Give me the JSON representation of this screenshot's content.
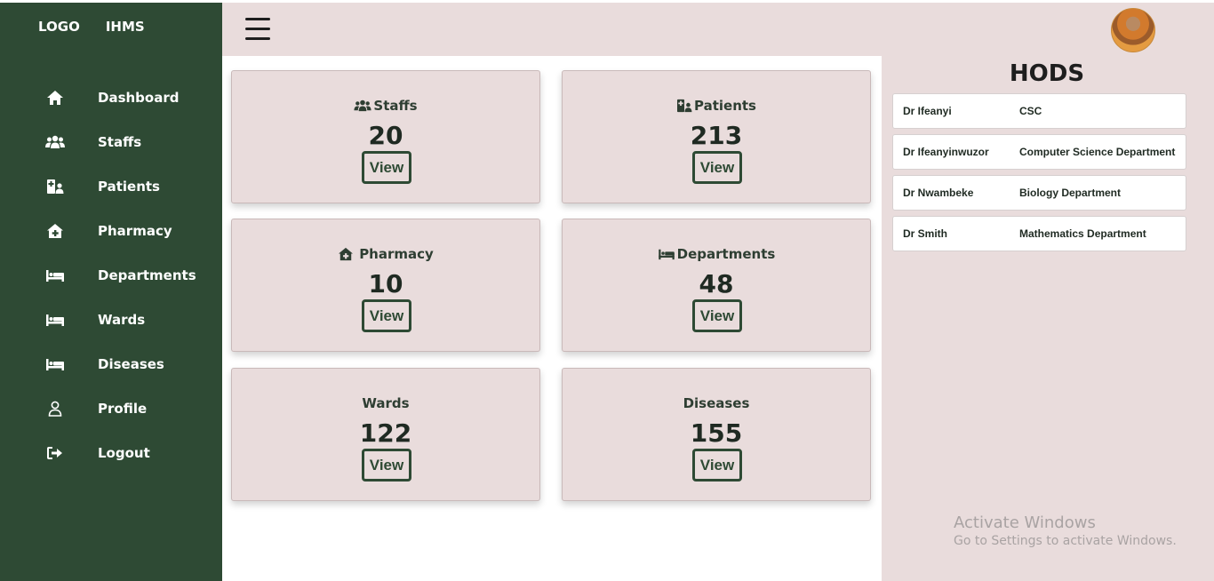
{
  "sidebar": {
    "logo": "LOGO",
    "app_name": "IHMS",
    "items": [
      {
        "label": "Dashboard",
        "icon": "home-icon"
      },
      {
        "label": "Staffs",
        "icon": "users-icon"
      },
      {
        "label": "Patients",
        "icon": "hospital-user-icon"
      },
      {
        "label": "Pharmacy",
        "icon": "house-medical-icon"
      },
      {
        "label": "Departments",
        "icon": "bed-icon"
      },
      {
        "label": "Wards",
        "icon": "bed-icon"
      },
      {
        "label": "Diseases",
        "icon": "bed-icon"
      },
      {
        "label": "Profile",
        "icon": "user-icon"
      },
      {
        "label": "Logout",
        "icon": "logout-icon"
      }
    ]
  },
  "header": {
    "menu_icon": "hamburger-icon",
    "avatar": "user-avatar"
  },
  "cards": [
    {
      "title": "Staffs",
      "count": "20",
      "button": "View",
      "icon": "users-icon"
    },
    {
      "title": "Patients",
      "count": "213",
      "button": "View",
      "icon": "hospital-user-icon"
    },
    {
      "title": "Pharmacy",
      "count": "10",
      "button": "View",
      "icon": "house-medical-icon"
    },
    {
      "title": "Departments",
      "count": "48",
      "button": "View",
      "icon": "bed-icon"
    },
    {
      "title": "Wards",
      "count": "122",
      "button": "View"
    },
    {
      "title": "Diseases",
      "count": "155",
      "button": "View"
    }
  ],
  "hods": {
    "heading": "HODS",
    "rows": [
      {
        "name": "Dr Ifeanyi",
        "dept": "CSC"
      },
      {
        "name": "Dr Ifeanyinwuzor",
        "dept": "Computer Science Department"
      },
      {
        "name": "Dr Nwambeke",
        "dept": "Biology Department"
      },
      {
        "name": "Dr Smith",
        "dept": "Mathematics Department"
      }
    ]
  },
  "watermark": {
    "line1": "Activate Windows",
    "line2": "Go to Settings to activate Windows."
  },
  "colors": {
    "sidebar_bg": "#2e4a34",
    "panel_bg": "#e9dcdc",
    "accent": "#2e4a34"
  }
}
